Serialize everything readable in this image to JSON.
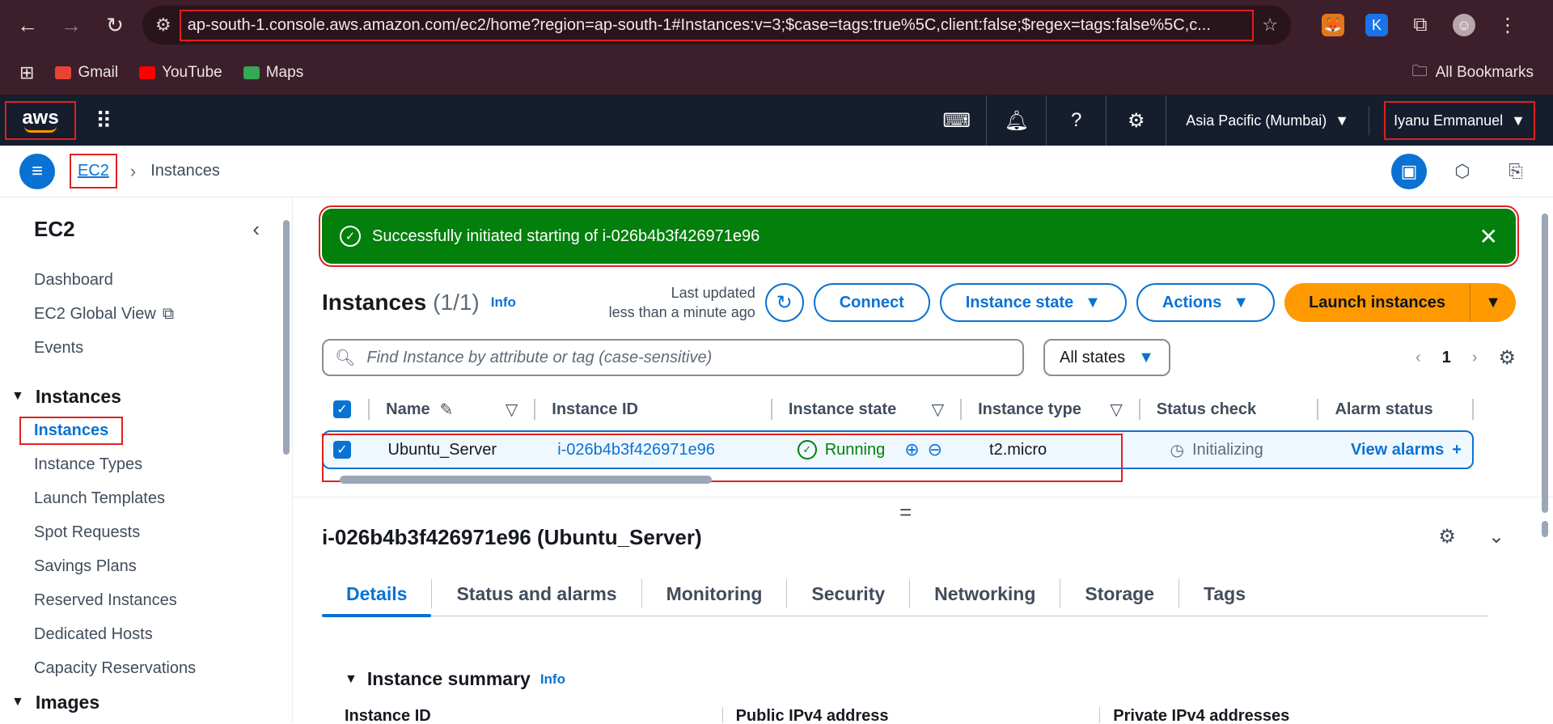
{
  "browser": {
    "url": "ap-south-1.console.aws.amazon.com/ec2/home?region=ap-south-1#Instances:v=3;$case=tags:true%5C,client:false;$regex=tags:false%5C,c...",
    "bookmarks": [
      "Gmail",
      "YouTube",
      "Maps"
    ],
    "all_bookmarks": "All Bookmarks"
  },
  "awsnav": {
    "logo": "aws",
    "region": "Asia Pacific (Mumbai)",
    "user": "Iyanu Emmanuel"
  },
  "breadcrumb": {
    "service": "EC2",
    "current": "Instances"
  },
  "sidebar": {
    "title": "EC2",
    "top_items": [
      "Dashboard",
      "EC2 Global View",
      "Events"
    ],
    "section_instances": "Instances",
    "instance_items": [
      "Instances",
      "Instance Types",
      "Launch Templates",
      "Spot Requests",
      "Savings Plans",
      "Reserved Instances",
      "Dedicated Hosts",
      "Capacity Reservations"
    ],
    "section_images": "Images"
  },
  "flash": {
    "message": "Successfully initiated starting of i-026b4b3f426971e96"
  },
  "toolbar": {
    "title": "Instances",
    "count": "(1/1)",
    "info": "Info",
    "updated_line1": "Last updated",
    "updated_line2": "less than a minute ago",
    "connect": "Connect",
    "instance_state": "Instance state",
    "actions": "Actions",
    "launch": "Launch instances"
  },
  "filter": {
    "placeholder": "Find Instance by attribute or tag (case-sensitive)",
    "states": "All states",
    "page": "1"
  },
  "table": {
    "headers": [
      "Name",
      "Instance ID",
      "Instance state",
      "Instance type",
      "Status check",
      "Alarm status"
    ],
    "row": {
      "name": "Ubuntu_Server",
      "id": "i-026b4b3f426971e96",
      "state": "Running",
      "type": "t2.micro",
      "status": "Initializing",
      "alarm": "View alarms"
    }
  },
  "detail": {
    "title": "i-026b4b3f426971e96 (Ubuntu_Server)",
    "tabs": [
      "Details",
      "Status and alarms",
      "Monitoring",
      "Security",
      "Networking",
      "Storage",
      "Tags"
    ],
    "summary": "Instance summary",
    "summary_info": "Info",
    "cols": [
      "Instance ID",
      "Public IPv4 address",
      "Private IPv4 addresses"
    ]
  },
  "colors": {
    "aws_orange": "#ff9900",
    "link_blue": "#0972d3",
    "success_green": "#037f0c",
    "nav_dark": "#161e2d"
  }
}
